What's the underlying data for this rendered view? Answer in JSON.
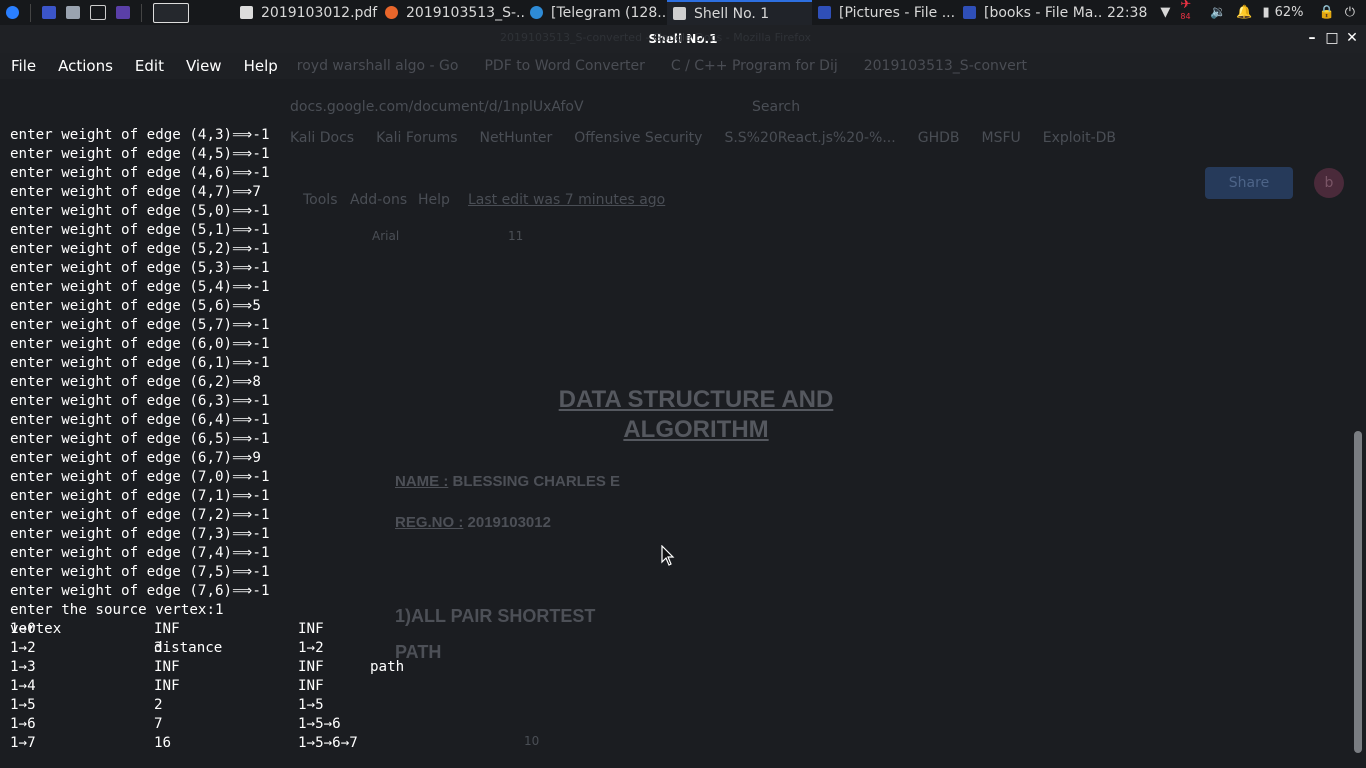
{
  "panel": {
    "tasks": [
      {
        "label": "2019103012.pdf",
        "icon": "pdf-file-icon"
      },
      {
        "label": "2019103513_S-...",
        "icon": "firefox-icon"
      },
      {
        "label": "[Telegram (128...",
        "icon": "telegram-icon"
      },
      {
        "label": "Shell No. 1",
        "icon": "terminal-icon"
      },
      {
        "label": "[Pictures - File ...",
        "icon": "folder-icon"
      },
      {
        "label": "[books - File Ma...",
        "icon": "folder-icon"
      }
    ],
    "clock": "22:38",
    "notification_badge": "84",
    "battery": "62%"
  },
  "window": {
    "title": "Shell No.1",
    "background_title": "2019103513_S-converted - Google Docs - Mozilla Firefox"
  },
  "menu": {
    "items": [
      "File",
      "Actions",
      "Edit",
      "View",
      "Help"
    ],
    "ghost_tabs": [
      "royd warshall algo - Go",
      "PDF to Word Converter",
      "C / C++ Program for Dij",
      "2019103513_S-convert"
    ]
  },
  "ghost": {
    "url": "docs.google.com/document/d/1nplUxAfoV",
    "search": "Search",
    "bookmarks": [
      "Kali Docs",
      "Kali Forums",
      "NetHunter",
      "Offensive Security",
      "S.S%20React.js%20-%...",
      "GHDB",
      "MSFU",
      "Exploit-DB"
    ],
    "doc_menu": [
      "Tools",
      "Add-ons",
      "Help"
    ],
    "last_edit": "Last edit was 7 minutes ago",
    "font": "Arial",
    "font_size": "11",
    "share": "Share",
    "avatar": "b",
    "doc_title_1": "DATA STRUCTURE AND",
    "doc_title_2": "ALGORITHM",
    "name_label": "NAME :",
    "name_value": "BLESSING CHARLES E",
    "reg_label": "REG.NO :",
    "reg_value": "2019103012",
    "section_1": "1)ALL  PAIR  SHORTEST",
    "section_2": "PATH",
    "page_num": "10"
  },
  "terminal": {
    "lines": [
      "enter weight of edge (4,3)⟹-1",
      "enter weight of edge (4,5)⟹-1",
      "enter weight of edge (4,6)⟹-1",
      "enter weight of edge (4,7)⟹7",
      "enter weight of edge (5,0)⟹-1",
      "enter weight of edge (5,1)⟹-1",
      "enter weight of edge (5,2)⟹-1",
      "enter weight of edge (5,3)⟹-1",
      "enter weight of edge (5,4)⟹-1",
      "enter weight of edge (5,6)⟹5",
      "enter weight of edge (5,7)⟹-1",
      "enter weight of edge (6,0)⟹-1",
      "enter weight of edge (6,1)⟹-1",
      "enter weight of edge (6,2)⟹8",
      "enter weight of edge (6,3)⟹-1",
      "enter weight of edge (6,4)⟹-1",
      "enter weight of edge (6,5)⟹-1",
      "enter weight of edge (6,7)⟹9",
      "enter weight of edge (7,0)⟹-1",
      "enter weight of edge (7,1)⟹-1",
      "enter weight of edge (7,2)⟹-1",
      "enter weight of edge (7,3)⟹-1",
      "enter weight of edge (7,4)⟹-1",
      "enter weight of edge (7,5)⟹-1",
      "enter weight of edge (7,6)⟹-1",
      "enter the source vertex:1"
    ],
    "table_headers": [
      "vertex",
      "distance",
      "path"
    ],
    "rows": [
      {
        "vertex": "1→0",
        "distance": "INF",
        "path": "INF"
      },
      {
        "vertex": "1→2",
        "distance": "3",
        "path": "1→2"
      },
      {
        "vertex": "1→3",
        "distance": "INF",
        "path": "INF"
      },
      {
        "vertex": "1→4",
        "distance": "INF",
        "path": "INF"
      },
      {
        "vertex": "1→5",
        "distance": "2",
        "path": "1→5"
      },
      {
        "vertex": "1→6",
        "distance": "7",
        "path": "1→5→6"
      },
      {
        "vertex": "1→7",
        "distance": "16",
        "path": "1→5→6→7"
      }
    ]
  },
  "colors": {
    "panel_bg": "#16181b",
    "terminal_bg": "#1b1d21",
    "terminal_fg": "#ffffff",
    "active_accent": "#2d6fe0"
  }
}
